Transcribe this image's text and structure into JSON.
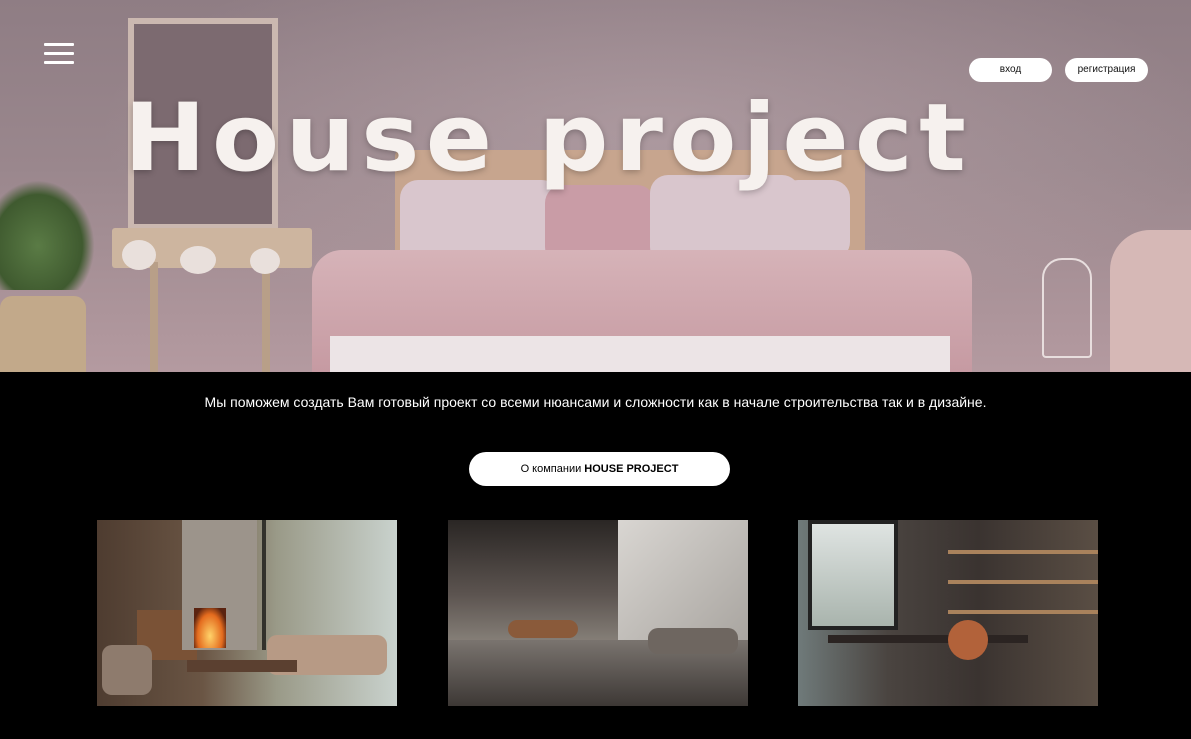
{
  "header": {
    "menu_icon": "hamburger-menu-icon",
    "login_label": "вход",
    "register_label": "регистрация"
  },
  "hero": {
    "title": "House project"
  },
  "intro": {
    "tagline": "Мы поможем создать Вам готовый проект со всеми нюансами и сложности как  в начале строительства так и в дизайне.",
    "about_button_prefix": "О компании ",
    "about_button_brand": "HOUSE PROJECT"
  },
  "gallery": [
    {
      "name": "living-room-fireplace"
    },
    {
      "name": "modern-hall-interior"
    },
    {
      "name": "home-office-interior"
    }
  ],
  "colors": {
    "background": "#000000",
    "button_bg": "#ffffff",
    "button_text": "#111111",
    "hero_tint": "#9a878d"
  }
}
